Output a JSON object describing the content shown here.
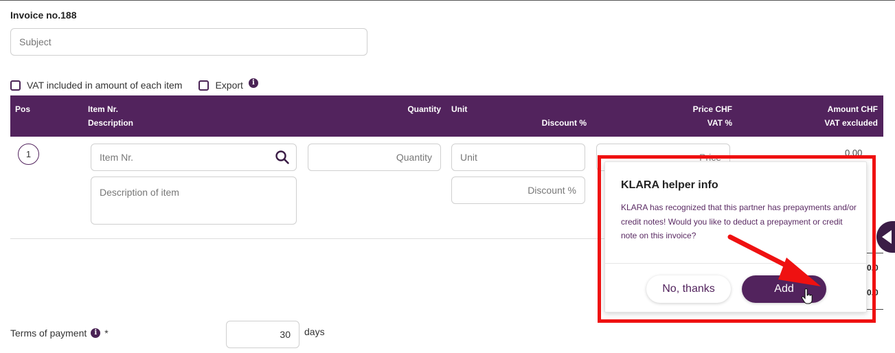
{
  "invoice": {
    "title": "Invoice no.188",
    "subject_placeholder": "Subject"
  },
  "options": {
    "vat_included_label": "VAT included in amount of each item",
    "export_label": "Export"
  },
  "table": {
    "headers": {
      "pos": "Pos",
      "item_nr": "Item Nr.",
      "description": "Description",
      "quantity": "Quantity",
      "unit": "Unit",
      "discount": "Discount %",
      "price": "Price CHF",
      "vat": "VAT %",
      "amount": "Amount CHF",
      "vat_excluded": "VAT excluded"
    },
    "row": {
      "pos": "1",
      "item_nr_placeholder": "Item Nr.",
      "description_placeholder": "Description of item",
      "quantity_placeholder": "Quantity",
      "unit_placeholder": "Unit",
      "discount_placeholder": "Discount %",
      "price_placeholder": "Price",
      "amount": "0.00"
    }
  },
  "summary": {
    "value_1": "0.0",
    "value_2": "0.0"
  },
  "terms": {
    "label": "Terms of payment",
    "required_mark": "*",
    "value": "30",
    "unit": "days"
  },
  "helper_popup": {
    "title": "KLARA helper info",
    "message": "KLARA has recognized that this partner has prepayments and/or credit notes! Would you like to deduct a prepayment or credit note on this invoice?",
    "no_label": "No, thanks",
    "add_label": "Add"
  },
  "colors": {
    "brand": "#52235d",
    "highlight": "#ef1111"
  }
}
